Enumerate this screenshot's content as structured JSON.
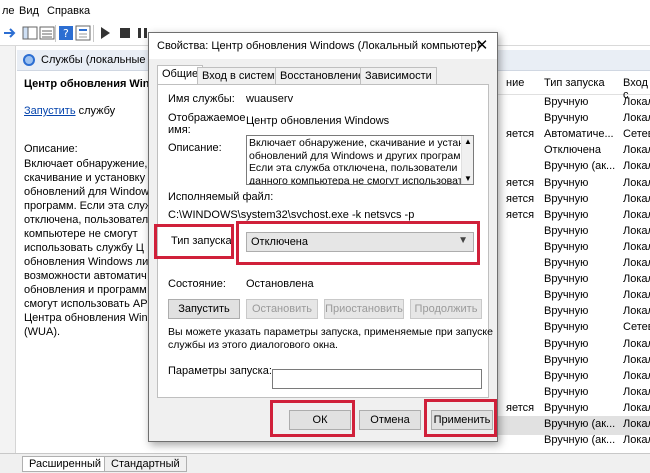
{
  "menubar": {
    "items": [
      "ле",
      "Вид",
      "Справка"
    ]
  },
  "toolbar": {
    "icons": [
      "back-icon",
      "forward-icon",
      "view-icon",
      "refresh-icon",
      "help-icon",
      "properties-icon",
      "play-icon",
      "stop-icon",
      "pause-icon",
      "restart-icon"
    ]
  },
  "services_header": {
    "title": "Службы (локальные"
  },
  "left_pane": {
    "title": "Центр обновления Windo",
    "start_link": "Запустить",
    "start_suffix": " службу",
    "desc_label": "Описание:",
    "desc_text": "Включает обнаружение,\nскачивание и установку\nобновлений для Windows\nпрограмм. Если эта служ\nотключена, пользовател\nкомпьютере не смогут\nиспользовать службу Ц\nобновления Windows ли\nвозможности автоматич\nобновления и программ\nсмогут использовать API\nЦентра обновления Wind\n(WUA)."
  },
  "columns": {
    "state": "ние",
    "start_type": "Тип запуска",
    "logon": "Вход с"
  },
  "rows": [
    {
      "state": "",
      "start_type": "Вручную",
      "logon": "Локал"
    },
    {
      "state": "",
      "start_type": "Вручную",
      "logon": "Локал"
    },
    {
      "state": "яется",
      "start_type": "Автоматиче...",
      "logon": "Сетева"
    },
    {
      "state": "",
      "start_type": "Отключена",
      "logon": "Локал"
    },
    {
      "state": "",
      "start_type": "Вручную (ак...",
      "logon": "Локал"
    },
    {
      "state": "яется",
      "start_type": "Вручную",
      "logon": "Локал"
    },
    {
      "state": "яется",
      "start_type": "Вручную",
      "logon": "Локал"
    },
    {
      "state": "яется",
      "start_type": "Вручную",
      "logon": "Локал"
    },
    {
      "state": "",
      "start_type": "Вручную",
      "logon": "Локал"
    },
    {
      "state": "",
      "start_type": "Вручную",
      "logon": "Локал"
    },
    {
      "state": "",
      "start_type": "Вручную",
      "logon": "Локал"
    },
    {
      "state": "",
      "start_type": "Вручную",
      "logon": "Локал"
    },
    {
      "state": "",
      "start_type": "Вручную",
      "logon": "Локал"
    },
    {
      "state": "",
      "start_type": "Вручную",
      "logon": "Локал"
    },
    {
      "state": "",
      "start_type": "Вручную",
      "logon": "Сетева"
    },
    {
      "state": "",
      "start_type": "Вручную",
      "logon": "Локал"
    },
    {
      "state": "",
      "start_type": "Вручную",
      "logon": "Локал"
    },
    {
      "state": "",
      "start_type": "Вручную",
      "logon": "Локал"
    },
    {
      "state": "",
      "start_type": "Вручную",
      "logon": "Локал"
    },
    {
      "state": "яется",
      "start_type": "Вручную",
      "logon": "Локал"
    },
    {
      "state": "",
      "start_type": "Вручную (ак...",
      "logon": "Локал"
    },
    {
      "state": "",
      "start_type": "Вручную (ак...",
      "logon": "Локал"
    }
  ],
  "bottom_tabs": {
    "extended": "Расширенный",
    "standard": "Стандартный"
  },
  "dialog": {
    "title": "Свойства: Центр обновления Windows (Локальный компьютер)",
    "close": "✕",
    "tabs": [
      "Общие",
      "Вход в систему",
      "Восстановление",
      "Зависимости"
    ],
    "service_name_label": "Имя службы:",
    "service_name": "wuauserv",
    "display_name_label": "Отображаемое\nимя:",
    "display_name": "Центр обновления Windows",
    "description_label": "Описание:",
    "description": "Включает обнаружение, скачивание и установку\nобновлений для Windows и других программ.\nЕсли эта служба отключена, пользователи\nданного компьютера не смогут использовать",
    "exe_label": "Исполняемый файл:",
    "exe_path": "C:\\WINDOWS\\system32\\svchost.exe -k netsvcs -p",
    "startup_label": "Тип запуска:",
    "startup_value": "Отключена",
    "status_label": "Состояние:",
    "status_value": "Остановлена",
    "btn_start": "Запустить",
    "btn_stop": "Остановить",
    "btn_pause": "Приостановить",
    "btn_resume": "Продолжить",
    "hint": "Вы можете указать параметры запуска, применяемые при запуске\nслужбы из этого диалогового окна.",
    "params_label": "Параметры запуска:",
    "params_value": "",
    "btn_ok": "ОК",
    "btn_cancel": "Отмена",
    "btn_apply": "Применить"
  },
  "colors": {
    "highlight": "#d0203a",
    "link": "#0645ad",
    "header_bg": "#e9eef5"
  }
}
